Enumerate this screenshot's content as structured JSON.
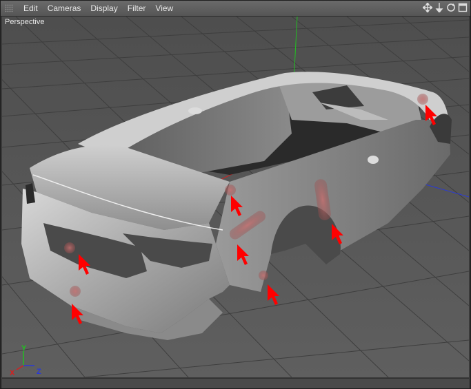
{
  "menubar": {
    "items": [
      "Edit",
      "Cameras",
      "Display",
      "Filter",
      "View"
    ]
  },
  "viewport": {
    "label": "Perspective",
    "axes": {
      "x": "X",
      "y": "Y",
      "z": "Z"
    },
    "colors": {
      "x_axis": "#d42020",
      "y_axis": "#21c021",
      "z_axis": "#2a3ad6",
      "marker": "#ff0000",
      "background": "#585858"
    }
  },
  "icons": {
    "nav": [
      "move-view-icon",
      "dolly-view-icon",
      "rotate-view-icon",
      "maximize-view-icon"
    ]
  }
}
